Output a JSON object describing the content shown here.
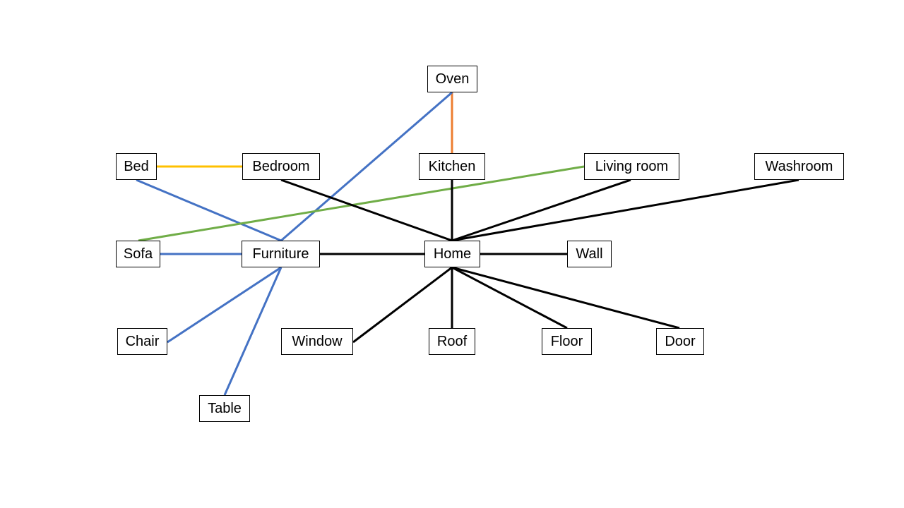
{
  "colors": {
    "black": "#000000",
    "blue": "#4472C4",
    "orange": "#ED7D31",
    "yellow": "#FFC000",
    "green": "#70AD47"
  },
  "nodes": [
    {
      "id": "oven",
      "label": "Oven"
    },
    {
      "id": "bed",
      "label": "Bed"
    },
    {
      "id": "bedroom",
      "label": "Bedroom"
    },
    {
      "id": "kitchen",
      "label": "Kitchen"
    },
    {
      "id": "livingroom",
      "label": "Living room"
    },
    {
      "id": "washroom",
      "label": "Washroom"
    },
    {
      "id": "sofa",
      "label": "Sofa"
    },
    {
      "id": "furniture",
      "label": "Furniture"
    },
    {
      "id": "home",
      "label": "Home"
    },
    {
      "id": "wall",
      "label": "Wall"
    },
    {
      "id": "chair",
      "label": "Chair"
    },
    {
      "id": "window",
      "label": "Window"
    },
    {
      "id": "roof",
      "label": "Roof"
    },
    {
      "id": "floor",
      "label": "Floor"
    },
    {
      "id": "door",
      "label": "Door"
    },
    {
      "id": "table",
      "label": "Table"
    }
  ],
  "edges": [
    {
      "from": "oven",
      "to": "kitchen",
      "color": "orange"
    },
    {
      "from": "bed",
      "to": "bedroom",
      "color": "yellow"
    },
    {
      "from": "bed",
      "to": "furniture",
      "color": "blue"
    },
    {
      "from": "oven",
      "to": "furniture",
      "color": "blue"
    },
    {
      "from": "sofa",
      "to": "livingroom",
      "color": "green"
    },
    {
      "from": "sofa",
      "to": "furniture",
      "color": "blue"
    },
    {
      "from": "furniture",
      "to": "chair",
      "color": "blue"
    },
    {
      "from": "furniture",
      "to": "table",
      "color": "blue"
    },
    {
      "from": "bedroom",
      "to": "home",
      "color": "black"
    },
    {
      "from": "kitchen",
      "to": "home",
      "color": "black"
    },
    {
      "from": "livingroom",
      "to": "home",
      "color": "black"
    },
    {
      "from": "washroom",
      "to": "home",
      "color": "black"
    },
    {
      "from": "furniture",
      "to": "home",
      "color": "black"
    },
    {
      "from": "home",
      "to": "wall",
      "color": "black"
    },
    {
      "from": "home",
      "to": "window",
      "color": "black"
    },
    {
      "from": "home",
      "to": "roof",
      "color": "black"
    },
    {
      "from": "home",
      "to": "floor",
      "color": "black"
    },
    {
      "from": "home",
      "to": "door",
      "color": "black"
    }
  ]
}
